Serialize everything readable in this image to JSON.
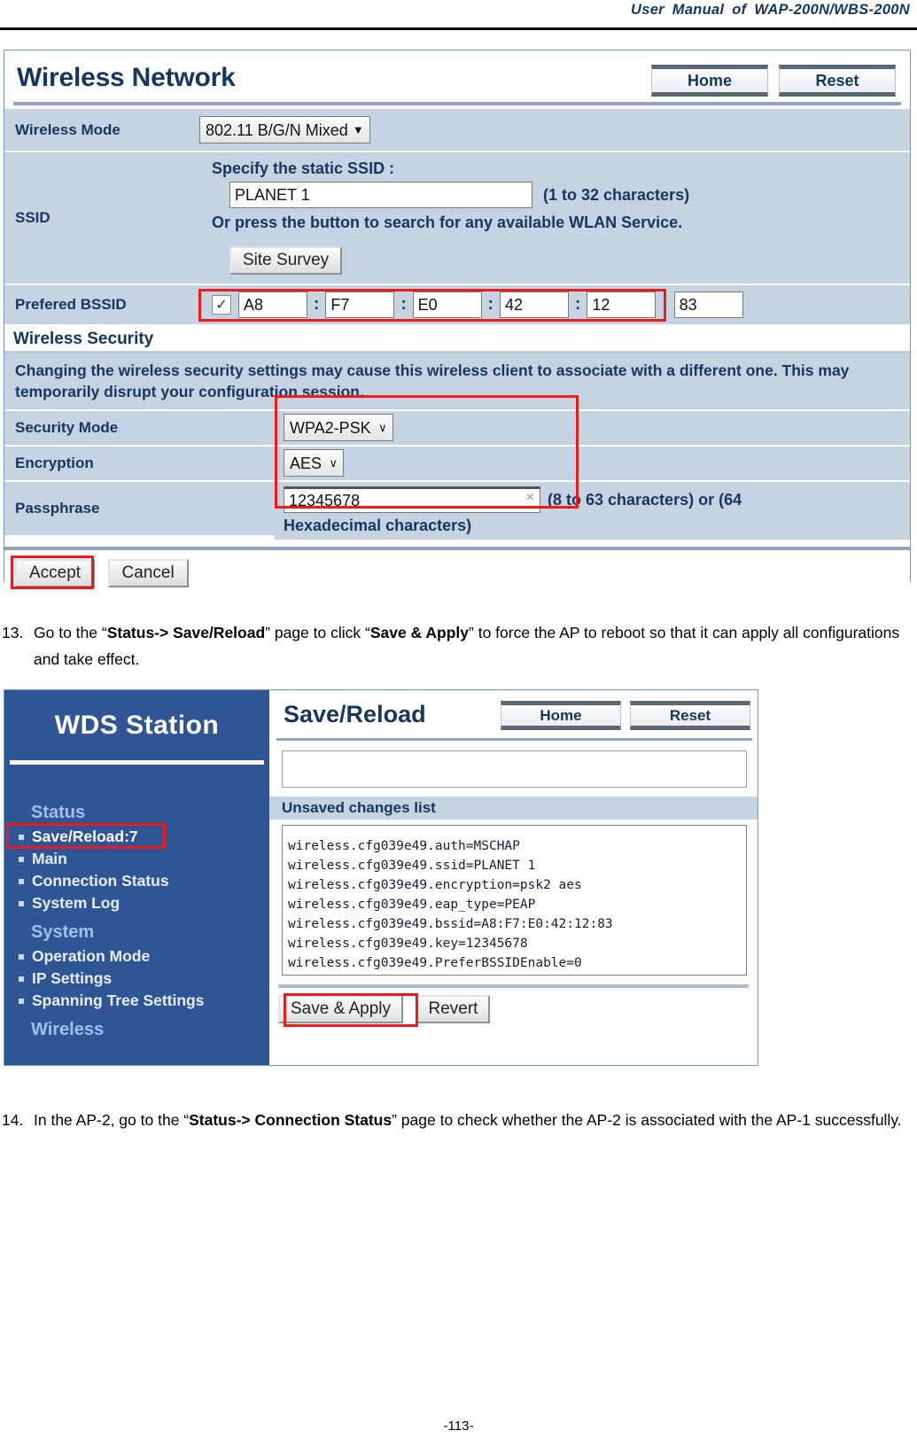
{
  "document": {
    "header_title": "User Manual of WAP-200N/WBS-200N",
    "page_number": "-113-"
  },
  "wireless_network": {
    "title": "Wireless Network",
    "home_button": "Home",
    "reset_button": "Reset",
    "wireless_mode_label": "Wireless Mode",
    "wireless_mode_value": "802.11 B/G/N Mixed",
    "ssid_label": "SSID",
    "ssid_specify_text": "Specify the static SSID  :",
    "ssid_value": "PLANET 1",
    "ssid_charhint": "(1 to 32 characters)",
    "ssid_or_text": "Or press the button to search for any available WLAN Service.",
    "site_survey_button": "Site Survey",
    "bssid_label": "Prefered BSSID",
    "bssid_checkbox_checked": "✓",
    "bssid_octets": [
      "A8",
      "F7",
      "E0",
      "42",
      "12",
      "83"
    ],
    "bssid_separator": ":",
    "security_section_title": "Wireless Security",
    "security_warning": "Changing the wireless security settings may cause this wireless client to associate with a different one. This may temporarily disrupt your configuration session.",
    "security_mode_label": "Security Mode",
    "security_mode_value": "WPA2-PSK",
    "encryption_label": "Encryption",
    "encryption_value": "AES",
    "passphrase_label": "Passphrase",
    "passphrase_value": "12345678",
    "passphrase_clear_icon": "×",
    "passphrase_hint_line1": "(8 to 63 characters) or (64",
    "passphrase_hint_line2": "Hexadecimal characters)",
    "accept_button": "Accept",
    "cancel_button": "Cancel",
    "highlight_color": "#ee1b18"
  },
  "step13": {
    "number": "13.",
    "part1": "Go to the “",
    "bold1": "Status-> Save/Reload",
    "part2": "” page to click “",
    "bold2": "Save & Apply",
    "part3": "” to force the AP to reboot so that it can apply all configurations and take effect."
  },
  "save_reload": {
    "sidebar_title": "WDS Station",
    "groups": [
      {
        "label": "Status",
        "items": [
          {
            "label": "Save/Reload:7",
            "active": true
          },
          {
            "label": "Main",
            "active": false
          },
          {
            "label": "Connection Status",
            "active": false
          },
          {
            "label": "System Log",
            "active": false
          }
        ]
      },
      {
        "label": "System",
        "items": [
          {
            "label": "Operation Mode",
            "active": false
          },
          {
            "label": "IP Settings",
            "active": false
          },
          {
            "label": "Spanning Tree Settings",
            "active": false
          }
        ]
      },
      {
        "label": "Wireless",
        "items": []
      }
    ],
    "title": "Save/Reload",
    "home_button": "Home",
    "reset_button": "Reset",
    "blank_field_value": "",
    "unsaved_header": "Unsaved changes list",
    "unsaved_lines": [
      "wireless.cfg039e49.auth=MSCHAP",
      "wireless.cfg039e49.ssid=PLANET 1",
      "wireless.cfg039e49.encryption=psk2 aes",
      "wireless.cfg039e49.eap_type=PEAP",
      "wireless.cfg039e49.bssid=A8:F7:E0:42:12:83",
      "wireless.cfg039e49.key=12345678",
      "wireless.cfg039e49.PreferBSSIDEnable=0"
    ],
    "save_apply_button": "Save & Apply",
    "revert_button": "Revert"
  },
  "step14": {
    "number": "14.",
    "part1": "In the AP-2, go to the “",
    "bold1": "Status-> Connection Status",
    "part2": "” page to check whether the AP-2 is associated with the AP-1 successfully."
  }
}
